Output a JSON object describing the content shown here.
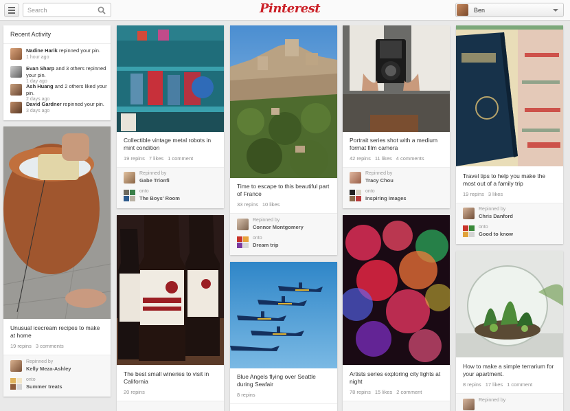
{
  "header": {
    "menu_icon": "hamburger-icon",
    "search_placeholder": "Search",
    "search_icon": "search-icon",
    "logo": "Pinterest",
    "brand_color": "#cb2027",
    "user_name": "Ben"
  },
  "recent_activity": {
    "title": "Recent Activity",
    "items": [
      {
        "name": "Nadine Harik",
        "action": "repinned your pin.",
        "time": "1 hour ago"
      },
      {
        "name": "Evan Sharp",
        "action": "and 3 others repinned your pin.",
        "time": "1 day ago"
      },
      {
        "name": "Ash Huang",
        "action": "and 2 others liked your pin.",
        "time": "2 days ago"
      },
      {
        "name": "David Gardner",
        "action": "repinned your pin.",
        "time": "3 days ago"
      }
    ]
  },
  "labels": {
    "repinned_by": "Repinned by",
    "onto": "onto"
  },
  "pins": [
    {
      "desc": "Unusual icecream recipes to make at home",
      "repins": "19 repins",
      "likes": "",
      "comments": "3 comments",
      "repinned_by": "Kelly Meza-Ashley",
      "board": "Summer treats"
    },
    {
      "desc": "Collectible vintage metal robots in mint condition",
      "repins": "19 repins",
      "likes": "7 likes",
      "comments": "1 comment",
      "repinned_by": "Gabe Trionfi",
      "board": "The Boys' Room"
    },
    {
      "desc": "The best small wineries to visit in California",
      "repins": "20 repins",
      "likes": "",
      "comments": "",
      "repinned_by": "",
      "board": ""
    },
    {
      "desc": "Time to escape to this beautiful part of France",
      "repins": "33 repins",
      "likes": "10 likes",
      "comments": "",
      "repinned_by": "Connor Montgomery",
      "board": "Dream trip"
    },
    {
      "desc": "Blue Angels flying over Seattle during Seafair",
      "repins": "8 repins",
      "likes": "",
      "comments": "",
      "repinned_by": "",
      "board": ""
    },
    {
      "desc": "Portrait series shot with a medium format film camera",
      "repins": "42 repins",
      "likes": "11 likes",
      "comments": "4 comments",
      "repinned_by": "Tracy Chou",
      "board": "Inspiring Images"
    },
    {
      "desc": "Artists series exploring city lights at night",
      "repins": "78 repins",
      "likes": "15 likes",
      "comments": "2 comment",
      "repinned_by": "",
      "board": ""
    },
    {
      "desc": "Travel tips to help you make the most out of a family trip",
      "repins": "19 repins",
      "likes": "3 likes",
      "comments": "",
      "repinned_by": "Chris Danford",
      "board": "Good to know"
    },
    {
      "desc": "How to make a simple terrarium for your apartment.",
      "repins": "8 repins",
      "likes": "17 likes",
      "comments": "1 comment",
      "repinned_by": "",
      "board": ""
    }
  ]
}
